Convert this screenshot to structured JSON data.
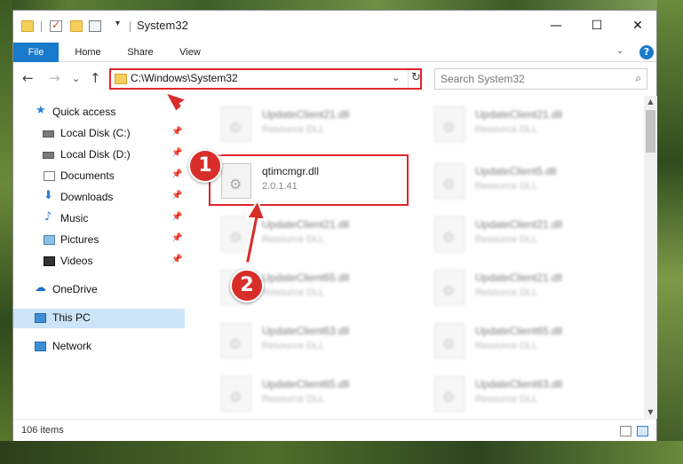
{
  "window": {
    "title": "System32",
    "controls": {
      "minimize": "—",
      "maximize": "☐",
      "close": "✕"
    }
  },
  "quick_access_toolbar": {
    "dropdown": "▾"
  },
  "ribbon": {
    "tabs": [
      {
        "label": "File"
      },
      {
        "label": "Home"
      },
      {
        "label": "Share"
      },
      {
        "label": "View"
      }
    ],
    "expand": "⌄",
    "help": "?"
  },
  "nav": {
    "back": "←",
    "forward": "→",
    "recent": "⌄",
    "up": "↑",
    "address_path": "C:\\Windows\\System32",
    "address_dropdown": "⌄",
    "refresh": "↻",
    "search_placeholder": "Search System32",
    "search_icon": "⌕"
  },
  "sidebar": {
    "items": [
      {
        "label": "Quick access",
        "icon": "star-icon",
        "pinned": false
      },
      {
        "label": "Local Disk (C:)",
        "icon": "drive-icon",
        "pinned": true
      },
      {
        "label": "Local Disk (D:)",
        "icon": "drive-icon",
        "pinned": true
      },
      {
        "label": "Documents",
        "icon": "documents-icon",
        "pinned": true
      },
      {
        "label": "Downloads",
        "icon": "download-icon",
        "pinned": true
      },
      {
        "label": "Music",
        "icon": "music-icon",
        "pinned": true
      },
      {
        "label": "Pictures",
        "icon": "pictures-icon",
        "pinned": true
      },
      {
        "label": "Videos",
        "icon": "videos-icon",
        "pinned": true
      },
      {
        "label": "OneDrive",
        "icon": "cloud-icon",
        "pinned": false
      },
      {
        "label": "This PC",
        "icon": "computer-icon",
        "pinned": false,
        "selected": true
      },
      {
        "label": "Network",
        "icon": "network-icon",
        "pinned": false
      }
    ],
    "pin_glyph": "📌",
    "star_glyph": "★",
    "download_glyph": "⬇",
    "music_glyph": "♪",
    "cloud_glyph": "☁"
  },
  "files": {
    "highlighted": {
      "name": "qtimcmgr.dll",
      "detail": "2.0.1.41"
    },
    "left_column": [
      {
        "name": "UpdateClient21.dll",
        "detail": "Resource DLL"
      },
      {
        "name": "UpdateClient21.dll",
        "detail": "Resource DLL"
      },
      {
        "name": "UpdateClient65.dll",
        "detail": "Resource DLL"
      },
      {
        "name": "UpdateClient63.dll",
        "detail": "Resource DLL"
      },
      {
        "name": "UpdateClient65.dll",
        "detail": "Resource DLL"
      }
    ],
    "right_column": [
      {
        "name": "UpdateClient21.dll",
        "detail": "Resource DLL"
      },
      {
        "name": "UpdateClient5.dll",
        "detail": "Resource DLL"
      },
      {
        "name": "UpdateClient21.dll",
        "detail": "Resource DLL"
      },
      {
        "name": "UpdateClient21.dll",
        "detail": "Resource DLL"
      },
      {
        "name": "UpdateClient65.dll",
        "detail": "Resource DLL"
      },
      {
        "name": "UpdateClient63.dll",
        "detail": "Resource DLL"
      }
    ]
  },
  "status": {
    "item_count": "106 items"
  },
  "annotations": {
    "step1": "1",
    "step2": "2",
    "color": "#d72e2a"
  },
  "colors": {
    "accent": "#1979ca",
    "highlight_border": "#e0242a",
    "selected_bg": "#cce4f7"
  },
  "scrollbar": {
    "up": "▲",
    "down": "▼"
  }
}
